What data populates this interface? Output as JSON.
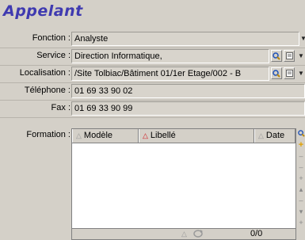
{
  "window": {
    "title": "Appelant"
  },
  "fields": {
    "fonction": {
      "label": "Fonction :",
      "value": "Analyste"
    },
    "service": {
      "label": "Service :",
      "value": "Direction Informatique,"
    },
    "localisation": {
      "label": "Localisation :",
      "value": "/Site Tolbiac/Bâtiment 01/1er Etage/002 - B"
    },
    "telephone": {
      "label": "Téléphone :",
      "value": "01 69 33 90 02"
    },
    "fax": {
      "label": "Fax :",
      "value": "01 69 33 90 99"
    }
  },
  "formation": {
    "label": "Formation :",
    "columns": [
      {
        "label": "Modèle",
        "sort_indicator": "gray"
      },
      {
        "label": "Libellé",
        "sort_indicator": "red"
      },
      {
        "label": "Date",
        "sort_indicator": "gray"
      }
    ],
    "footer_count": "0/0"
  },
  "icons": {
    "search": "magnifier-icon",
    "details": "details-icon",
    "dropdown": "chevron-down-icon",
    "add": "plus-icon"
  },
  "colors": {
    "title": "#3f3ab0",
    "background": "#d4d0c8",
    "sort_active": "#d0141c"
  }
}
